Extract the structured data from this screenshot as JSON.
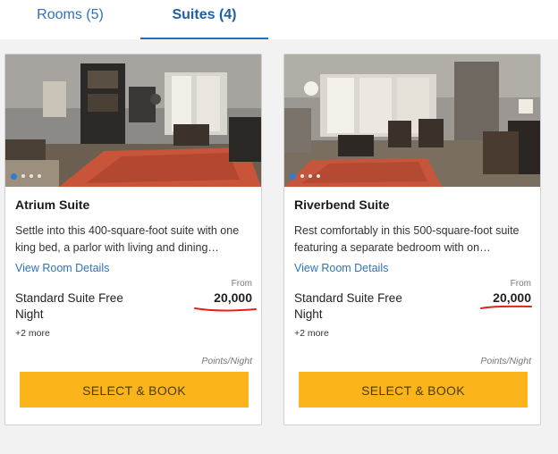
{
  "tabs": [
    {
      "label": "Rooms (5)",
      "selected": false
    },
    {
      "label": "Suites (4)",
      "selected": true
    }
  ],
  "cards": [
    {
      "title": "Atrium Suite",
      "description": "Settle into this 400-square-foot suite with one king bed, a parlor with living and dining…",
      "details_link": "View Room Details",
      "from_label": "From",
      "rate_name": "Standard Suite Free Night",
      "points": "20,000",
      "more": "+2 more",
      "unit": "Points/Night",
      "button": "SELECT & BOOK",
      "carousel": {
        "count": 4,
        "active_index": 0
      }
    },
    {
      "title": "Riverbend Suite",
      "description": "Rest comfortably in this 500-square-foot suite featuring a separate bedroom with on…",
      "details_link": "View Room Details",
      "from_label": "From",
      "rate_name": "Standard Suite Free Night",
      "points": "20,000",
      "more": "+2 more",
      "unit": "Points/Night",
      "button": "SELECT & BOOK",
      "carousel": {
        "count": 4,
        "active_index": 0
      }
    }
  ],
  "colors": {
    "accent_blue": "#2f73b8",
    "button_yellow": "#fbb51b",
    "annotation_red": "#e0231b"
  }
}
